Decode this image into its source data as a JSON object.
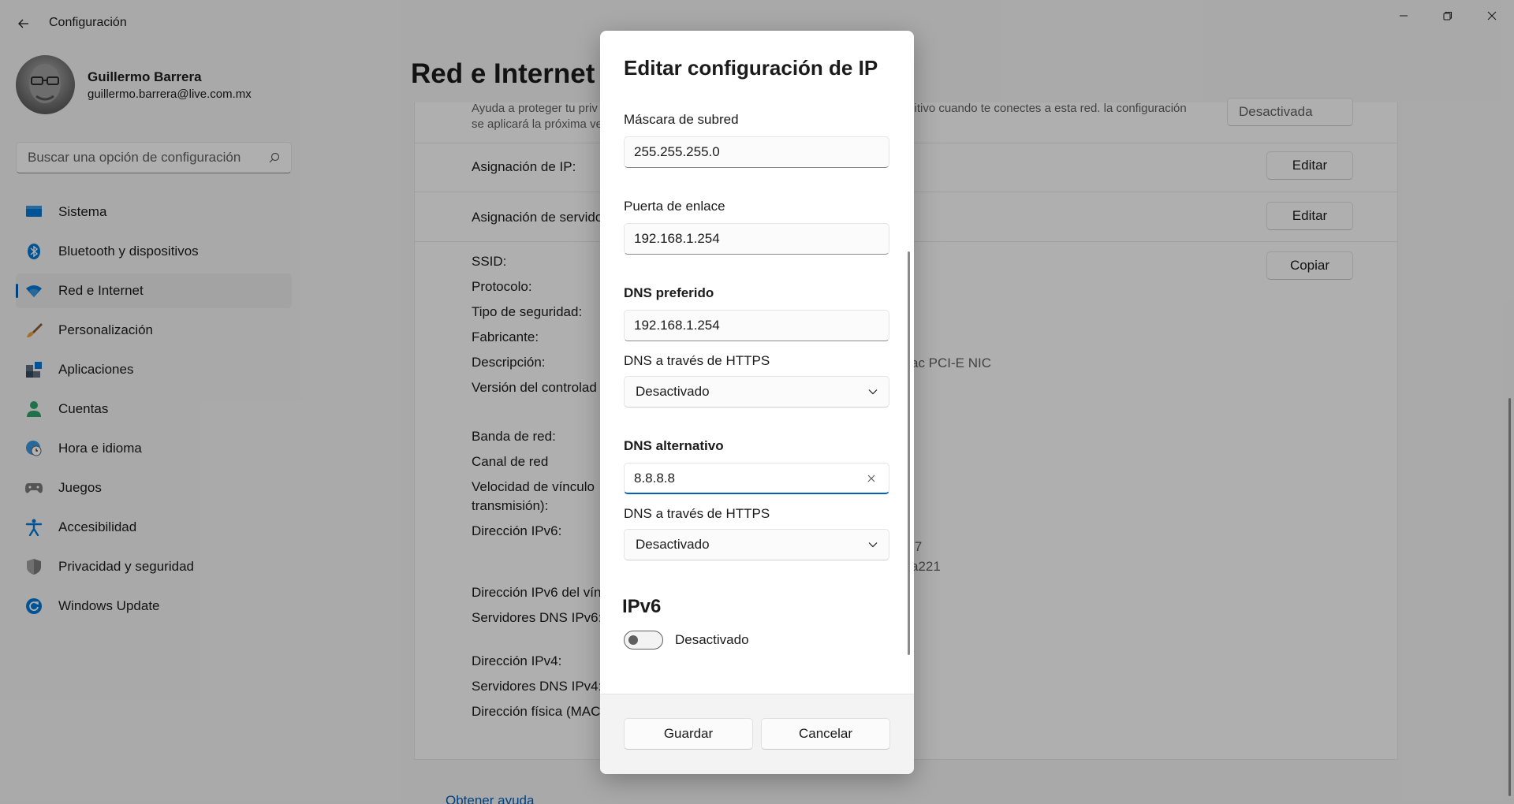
{
  "window": {
    "title": "Configuración"
  },
  "profile": {
    "name": "Guillermo Barrera",
    "email": "guillermo.barrera@live.com.mx"
  },
  "search": {
    "placeholder": "Buscar una opción de configuración"
  },
  "nav": {
    "items": [
      {
        "label": "Sistema",
        "icon": "monitor-icon"
      },
      {
        "label": "Bluetooth y dispositivos",
        "icon": "bluetooth-icon"
      },
      {
        "label": "Red e Internet",
        "icon": "wifi-icon",
        "active": true
      },
      {
        "label": "Personalización",
        "icon": "brush-icon"
      },
      {
        "label": "Aplicaciones",
        "icon": "apps-icon"
      },
      {
        "label": "Cuentas",
        "icon": "person-icon"
      },
      {
        "label": "Hora e idioma",
        "icon": "clock-globe-icon"
      },
      {
        "label": "Juegos",
        "icon": "gamepad-icon"
      },
      {
        "label": "Accesibilidad",
        "icon": "accessibility-icon"
      },
      {
        "label": "Privacidad y seguridad",
        "icon": "shield-icon"
      },
      {
        "label": "Windows Update",
        "icon": "update-icon"
      }
    ]
  },
  "main": {
    "page_title": "Red e Internet",
    "random_hw_text_1": "Ayuda a proteger tu priv",
    "random_hw_text_1b": "sitivo cuando te conectes a esta red. la configuración",
    "random_hw_text_2": "se aplicará la próxima ve",
    "random_hw_dropdown": "Desactivada",
    "ip_assignment_label": "Asignación de IP:",
    "dns_assignment_label": "Asignación de servidor",
    "edit_label": "Editar",
    "copy_label": "Copiar",
    "details": {
      "ssid": "SSID:",
      "protocol": "Protocolo:",
      "security": "Tipo de seguridad:",
      "manufacturer": "Fabricante:",
      "description": "Descripción:",
      "driver": "Versión del controlad",
      "band": "Banda de red:",
      "channel": "Canal de red",
      "link_speed_1": "Velocidad de vínculo",
      "link_speed_2": "transmisión):",
      "ipv6": "Dirección IPv6:",
      "ipv6_link": "Dirección IPv6 del vín",
      "ipv6_dns": "Servidores DNS IPv6:",
      "ipv4": "Dirección IPv4:",
      "ipv4_dns": "Servidores DNS IPv4:",
      "mac": "Dirección física (MAC"
    },
    "description_value": "ac PCI-E NIC",
    "ipv6_value_1": ":7",
    "ipv6_value_2": "a221",
    "help_link": "Obtener ayuda"
  },
  "dialog": {
    "title": "Editar configuración de IP",
    "subnet_label": "Máscara de subred",
    "subnet_value": "255.255.255.0",
    "gateway_label": "Puerta de enlace",
    "gateway_value": "192.168.1.254",
    "preferred_dns_label": "DNS preferido",
    "preferred_dns_value": "192.168.1.254",
    "doh_label_1": "DNS a través de HTTPS",
    "doh_value_1": "Desactivado",
    "alternate_dns_label": "DNS alternativo",
    "alternate_dns_value": "8.8.8.8",
    "doh_label_2": "DNS a través de HTTPS",
    "doh_value_2": "Desactivado",
    "ipv6_title": "IPv6",
    "ipv6_toggle_label": "Desactivado",
    "save_label": "Guardar",
    "cancel_label": "Cancelar"
  },
  "colors": {
    "accent": "#005fb8",
    "background": "#f3f3f3",
    "card": "#fbfbfb",
    "overlay": "rgba(0,0,0,0.30)"
  }
}
